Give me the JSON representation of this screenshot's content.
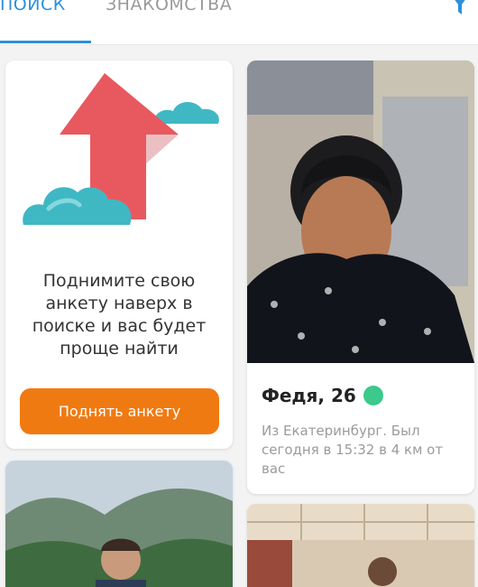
{
  "tabs": {
    "search_label": "ПОИСК",
    "dating_label": "ЗНАКОМСТВА",
    "active": "search"
  },
  "icons": {
    "filter": "filter-icon",
    "promo_art": "up-arrow-clouds-illustration",
    "online": "online-status-dot"
  },
  "colors": {
    "accent": "#2f8fd8",
    "button": "#f07a12",
    "online": "#3cc98b",
    "arrow": "#e8595f",
    "cloud": "#3fb8c4"
  },
  "promo": {
    "text": "Поднимите свою\nанкету наверх в\nпоиске и вас будет\nпроще найти",
    "button_label": "Поднять анкету"
  },
  "profile": {
    "name": "Федя, 26",
    "description": "Из Екатеринбург. Был сегодня в 15:32 в 4 км от вас",
    "online": true
  }
}
